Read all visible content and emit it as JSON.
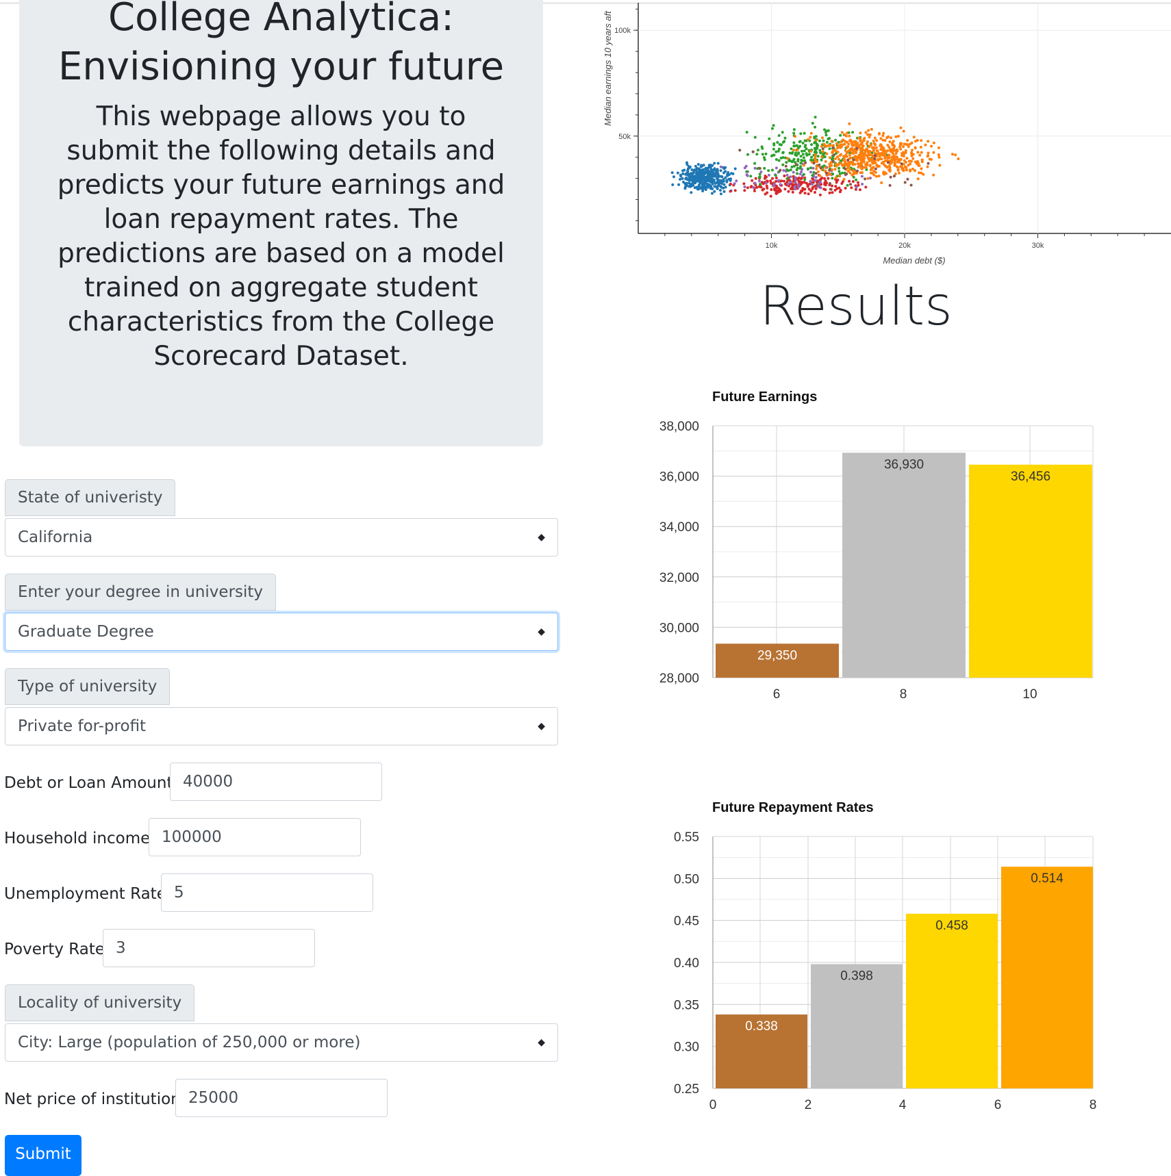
{
  "header": {
    "title": "College Analytica: Envisioning your future",
    "description": "This webpage allows you to submit the following details and predicts your future earnings and loan repayment rates. The predictions are based on a model trained on aggregate student characteristics from the College Scorecard Dataset."
  },
  "form": {
    "state": {
      "label": "State of univeristy",
      "value": "California"
    },
    "degree": {
      "label": "Enter your degree in university",
      "value": "Graduate Degree"
    },
    "type": {
      "label": "Type of university",
      "value": "Private for-profit"
    },
    "debt": {
      "label": "Debt or Loan Amount",
      "value": "40000"
    },
    "income": {
      "label": "Household income",
      "value": "100000"
    },
    "unemployment": {
      "label": "Unemployment Rate",
      "value": "5"
    },
    "poverty": {
      "label": "Poverty Rate",
      "value": "3"
    },
    "locality": {
      "label": "Locality of university",
      "value": "City: Large (population of 250,000 or more)"
    },
    "net_price": {
      "label": "Net price of institution",
      "value": "25000"
    },
    "submit_label": "Submit"
  },
  "results": {
    "title": "Results"
  },
  "chart_data": [
    {
      "type": "scatter",
      "title": "",
      "xlabel": "Median debt ($)",
      "ylabel": "Median earnings 10 years aft",
      "xticks": [
        "10k",
        "20k",
        "30k"
      ],
      "yticks": [
        "50k",
        "100k"
      ],
      "xlim": [
        0,
        40000
      ],
      "ylim": [
        4000,
        113000
      ],
      "grid": true,
      "series_colors": [
        "#1f77b4",
        "#ff7f0e",
        "#2ca02c",
        "#d62728",
        "#9467bd",
        "#8c564b"
      ]
    },
    {
      "type": "bar",
      "title": "Future Earnings",
      "categories": [
        "6",
        "8",
        "10"
      ],
      "values": [
        29350,
        36930,
        36456
      ],
      "value_labels": [
        "29,350",
        "36,930",
        "36,456"
      ],
      "colors": [
        "#b87333",
        "#c0c0c0",
        "#ffd700"
      ],
      "yticks": [
        "38,000",
        "36,000",
        "34,000",
        "32,000",
        "30,000",
        "28,000"
      ],
      "ylim": [
        28000,
        38000
      ]
    },
    {
      "type": "bar",
      "title": "Future Repayment Rates",
      "categories": [
        "0",
        "2",
        "4",
        "6",
        "8"
      ],
      "values": [
        0.338,
        0.398,
        0.458,
        0.514
      ],
      "value_labels": [
        "0.338",
        "0.398",
        "0.458",
        "0.514"
      ],
      "colors": [
        "#b87333",
        "#c0c0c0",
        "#ffd700",
        "#ffa500"
      ],
      "yticks": [
        "0.55",
        "0.50",
        "0.45",
        "0.40",
        "0.35",
        "0.30",
        "0.25"
      ],
      "ylim": [
        0.25,
        0.55
      ]
    }
  ]
}
